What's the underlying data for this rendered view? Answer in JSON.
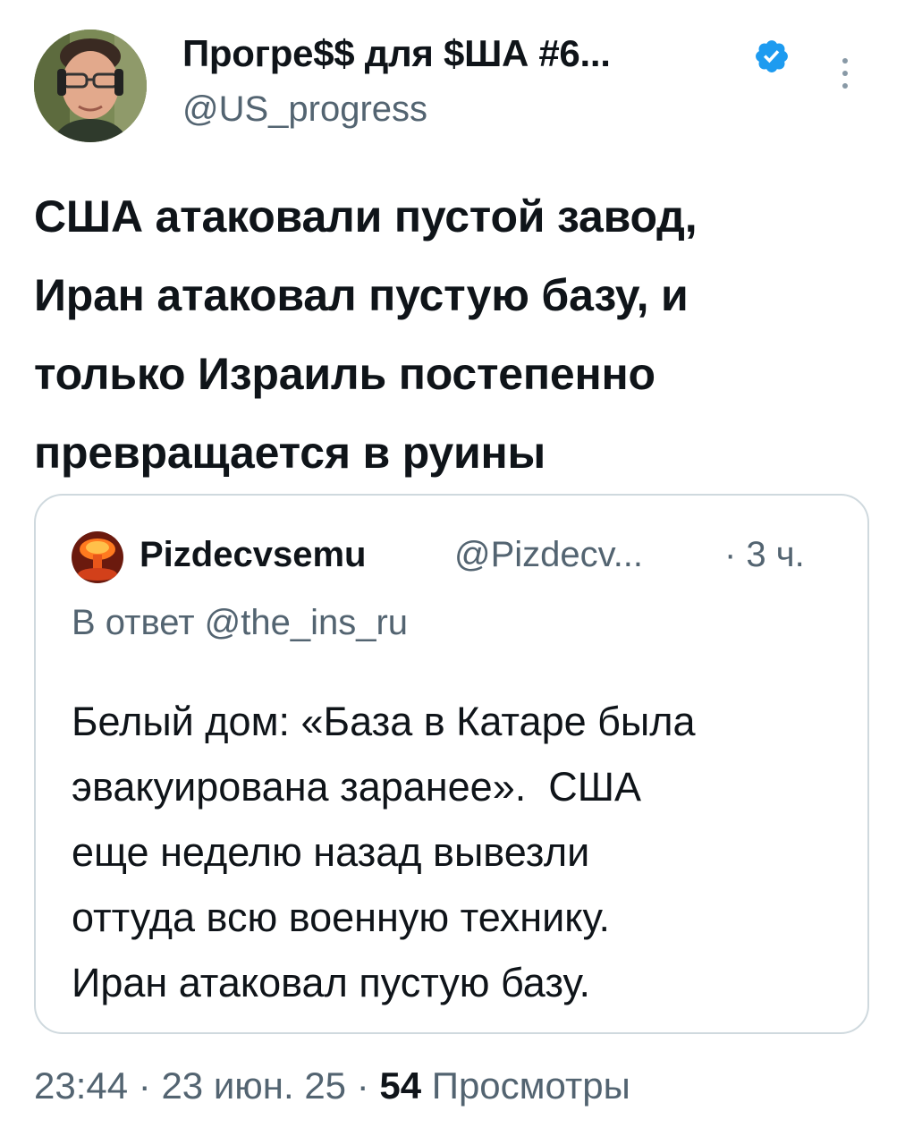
{
  "author": {
    "display_name": "Прогре$$ для $ША #6...",
    "handle": "@US_progress",
    "verified_icon": "verified-badge-icon",
    "avatar_icon": "profile-photo"
  },
  "tweet": {
    "lines": [
      "США атаковали пустой завод,",
      "Иран атаковал пустую базу, и",
      "только Израиль постепенно",
      "превращается в руины"
    ]
  },
  "quote": {
    "display_name": "Pizdecvsemu",
    "handle": "@Pizdecv...",
    "time": "· 3 ч.",
    "reply_to": "В ответ @the_ins_ru",
    "lines": [
      "Белый дом: «База в Катаре была",
      "эвакуирована заранее».  США",
      "еще неделю назад вывезли",
      "оттуда всю военную технику.",
      "Иран атаковал пустую базу."
    ]
  },
  "footer": {
    "time": "23:44",
    "date": "23 июн. 25",
    "views_count": "54",
    "views_label": "Просмотры",
    "separator": " · "
  },
  "colors": {
    "primary_text": "#0f1419",
    "secondary_text": "#536471",
    "border": "#cfd9de",
    "verified": "#1d9bf0"
  }
}
